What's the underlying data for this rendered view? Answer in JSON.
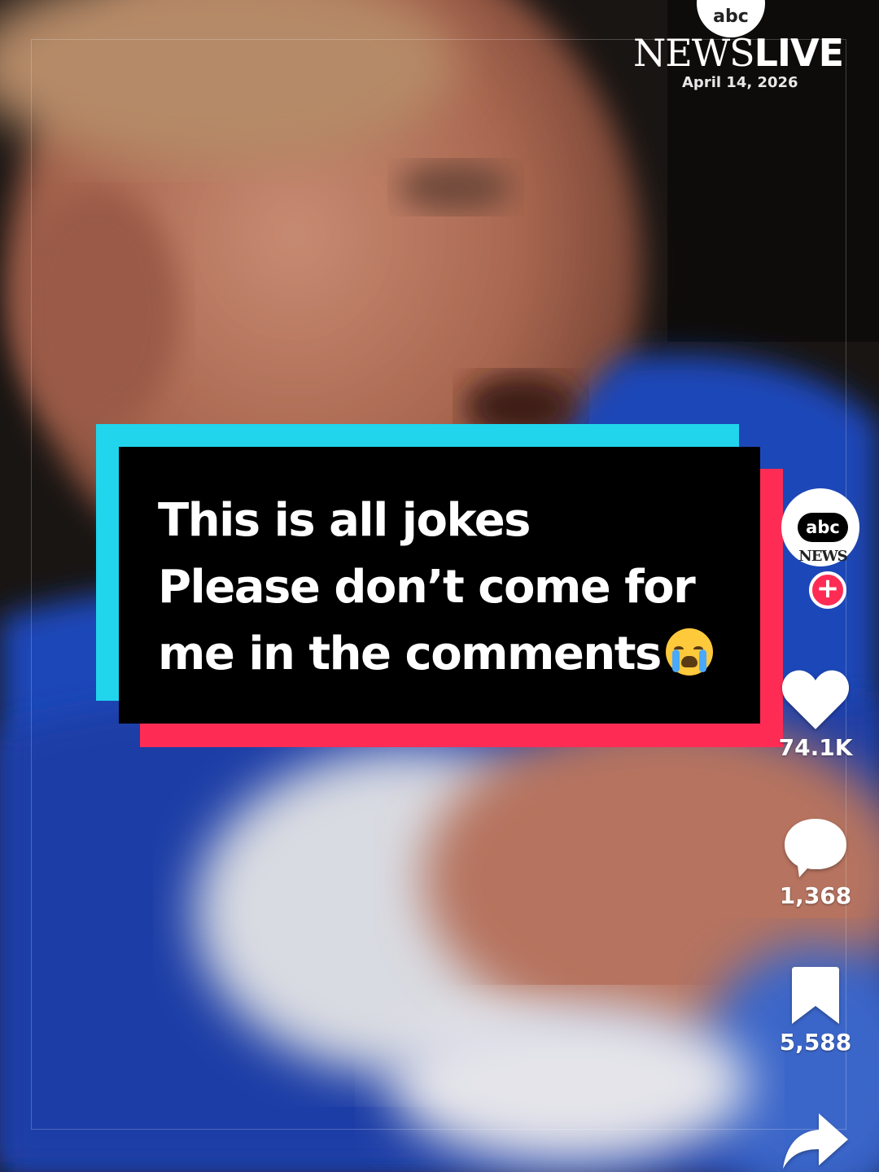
{
  "overlay": {
    "logo_circle_text": "abc",
    "logo_news": "NEWS",
    "logo_live": "LIVE",
    "date": "April 14, 2026"
  },
  "caption": {
    "lines": [
      "This is all jokes",
      "Please don’t come for",
      "me in the comments"
    ],
    "emoji_icon": "loudly-crying-face-icon"
  },
  "account": {
    "avatar_text_top": "abc",
    "avatar_text_bottom": "NEWS",
    "follow_label": "+"
  },
  "actions": {
    "likes": "74.1K",
    "comments": "1,368",
    "saves": "5,588"
  },
  "colors": {
    "caption_accent_cyan": "#20d5ec",
    "caption_accent_red": "#fe2c55",
    "follow_button": "#fe2c55"
  }
}
